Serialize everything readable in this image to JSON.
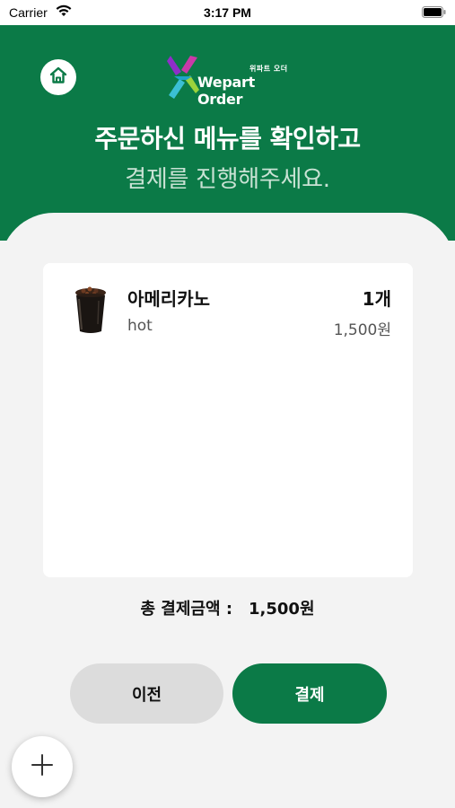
{
  "status_bar": {
    "carrier": "Carrier",
    "time": "3:17 PM"
  },
  "header": {
    "logo_small": "위파트 오더",
    "logo_text": "Wepart Order",
    "headline": "주문하신 메뉴를 확인하고",
    "subline": "결제를 진행해주세요.",
    "accent_color": "#0b7a47"
  },
  "order": {
    "items": [
      {
        "name": "아메리카노",
        "option": "hot",
        "quantity": "1개",
        "price": "1,500원"
      }
    ]
  },
  "total": {
    "label": "총 결제금액 :",
    "amount": "1,500원"
  },
  "buttons": {
    "prev_label": "이전",
    "pay_label": "결제"
  },
  "icons": {
    "home": "home-icon",
    "fab": "plus-icon"
  }
}
